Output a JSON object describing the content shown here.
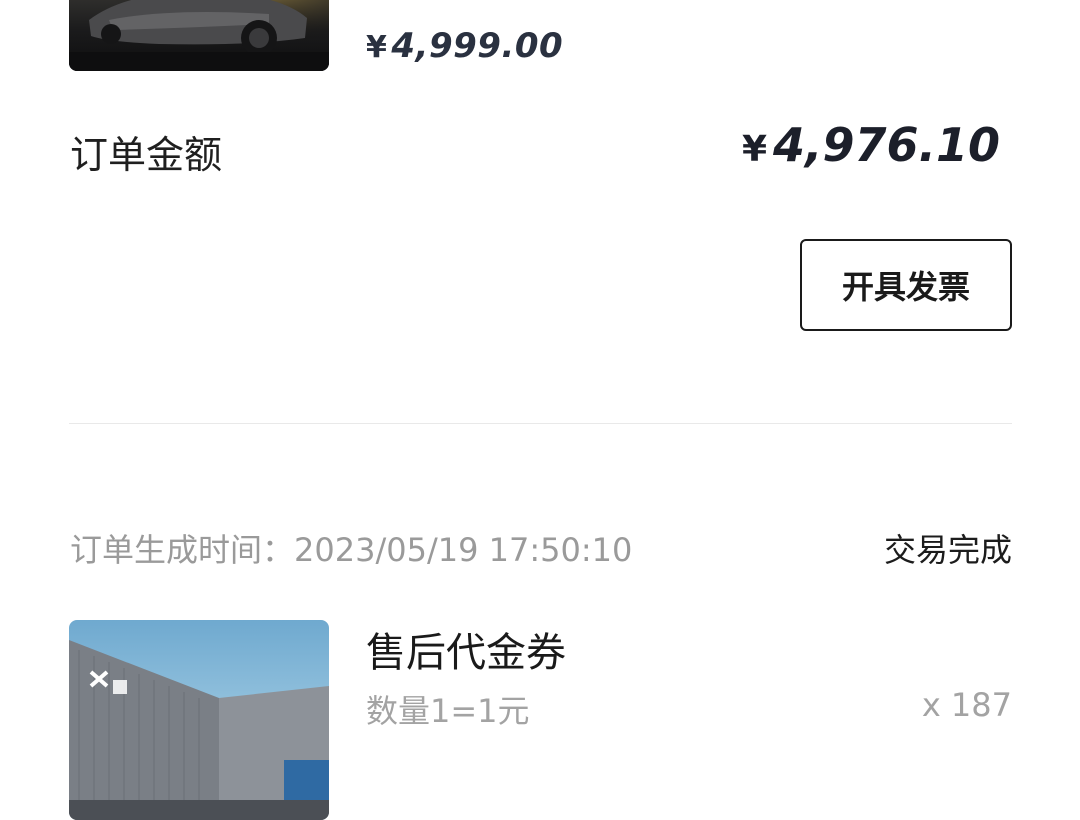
{
  "order1": {
    "price_symbol": "¥",
    "price_value": "4,999.00",
    "image_icon": "car-product-image"
  },
  "total": {
    "label": "订单金额",
    "symbol": "¥",
    "value": "4,976.10"
  },
  "actions": {
    "invoice_label": "开具发票"
  },
  "order2": {
    "time_label": "订单生成时间：",
    "time_value": "2023/05/19 17:50:10",
    "status": "交易完成",
    "product_name": "售后代金券",
    "product_desc": "数量1=1元",
    "quantity": "x 187",
    "image_icon": "store-building-image"
  },
  "colors": {
    "text_primary": "#1a1a1a",
    "text_secondary": "#a3a3a3",
    "price": "#2a3140",
    "divider": "#e9e9e9"
  }
}
